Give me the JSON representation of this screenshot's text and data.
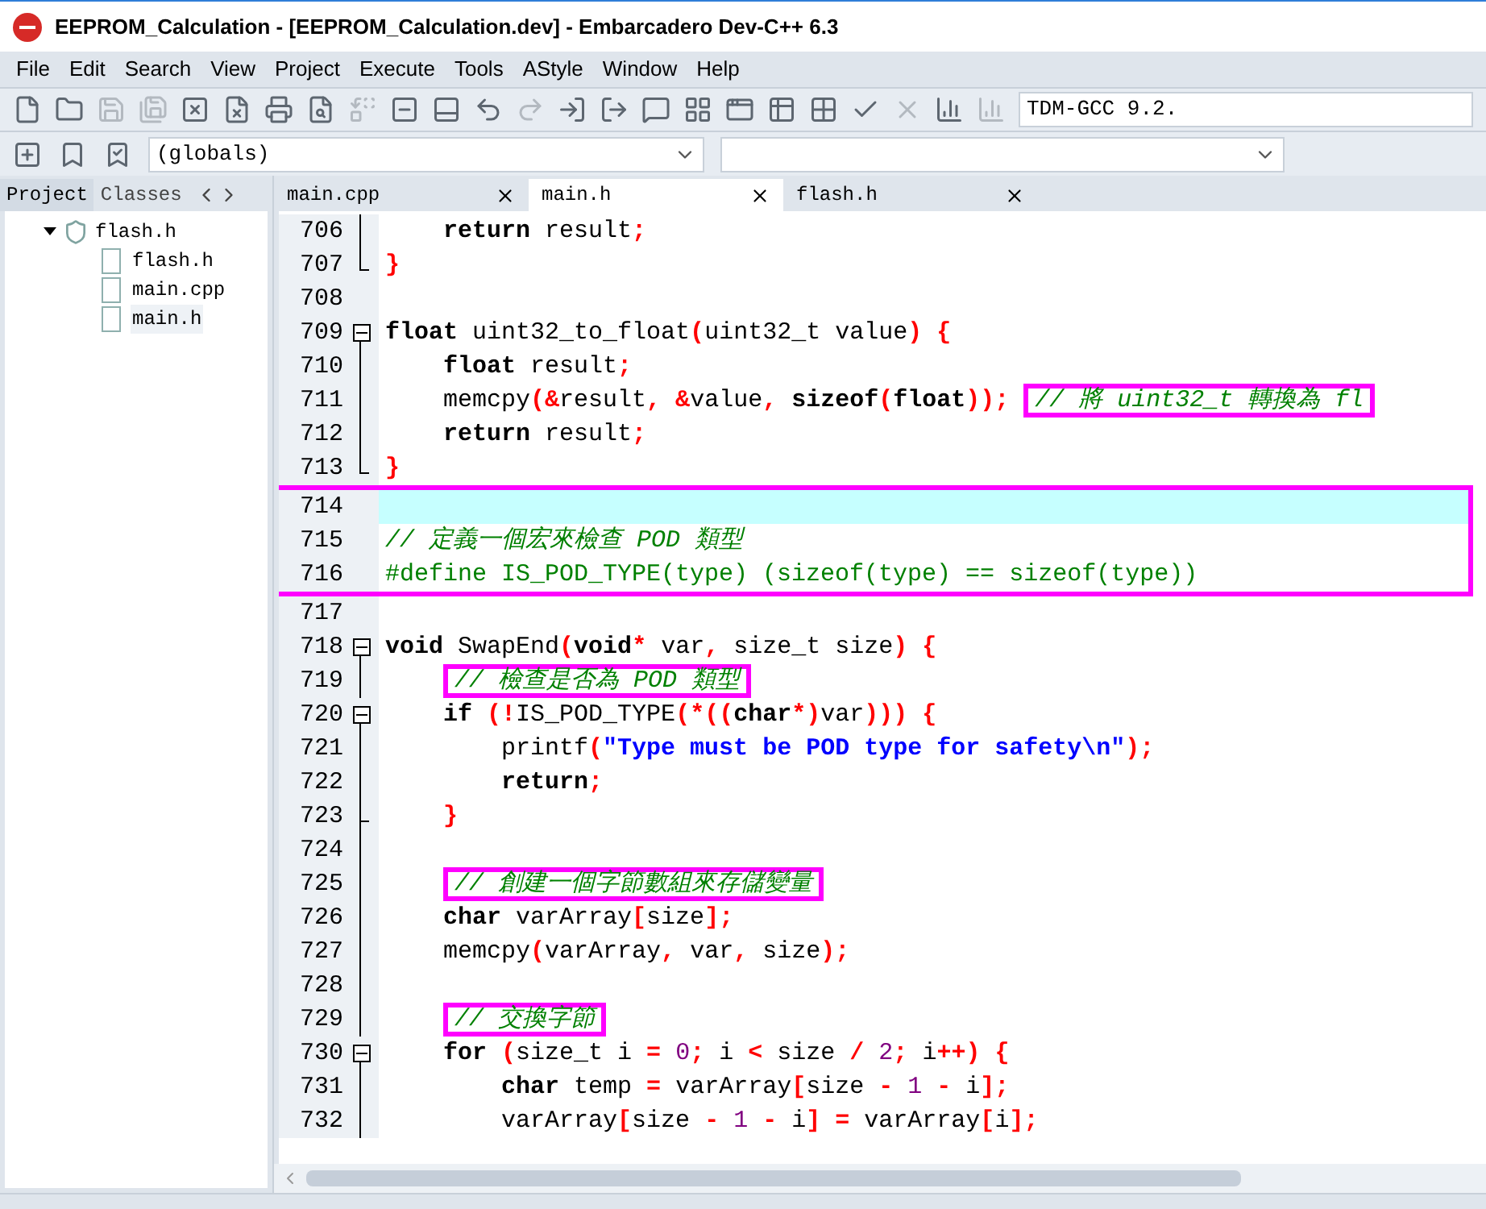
{
  "window": {
    "title": "EEPROM_Calculation - [EEPROM_Calculation.dev] - Embarcadero Dev-C++ 6.3"
  },
  "menu": [
    "File",
    "Edit",
    "Search",
    "View",
    "Project",
    "Execute",
    "Tools",
    "AStyle",
    "Window",
    "Help"
  ],
  "toolbar": {
    "compiler": "TDM-GCC 9.2.",
    "scope": "(globals)"
  },
  "side_tabs": [
    {
      "label": "Project",
      "selected": true
    },
    {
      "label": "Classes",
      "selected": false
    }
  ],
  "editor_tabs": [
    {
      "label": "main.cpp",
      "selected": false
    },
    {
      "label": "main.h",
      "selected": true
    },
    {
      "label": "flash.h",
      "selected": false
    }
  ],
  "project_tree": {
    "label": "flash.h",
    "expanded": true,
    "children": [
      {
        "label": "flash.h",
        "selected": false
      },
      {
        "label": "main.cpp",
        "selected": false
      },
      {
        "label": "main.h",
        "selected": true
      }
    ]
  },
  "code_blocks": [
    {
      "kind": "plain",
      "lines": [
        {
          "number": "706",
          "kind": "fold_line",
          "current": false,
          "segments": [
            {
              "kind": "keyword",
              "text": "    return"
            },
            {
              "kind": "plain",
              "text": " result"
            },
            {
              "kind": "symbol",
              "text": ";"
            }
          ]
        },
        {
          "number": "707",
          "kind": "fold_end",
          "current": false,
          "segments": [
            {
              "kind": "symbol",
              "text": "}"
            }
          ]
        },
        {
          "number": "708",
          "kind": "plain",
          "current": false
        },
        {
          "number": "709",
          "kind": "fold_open",
          "current": false,
          "segments": [
            {
              "kind": "keyword",
              "text": "float"
            },
            {
              "kind": "plain",
              "text": " uint32_to_float"
            },
            {
              "kind": "symbol",
              "text": "("
            },
            {
              "kind": "plain",
              "text": "uint32_t value"
            },
            {
              "kind": "symbol",
              "text": ")"
            },
            {
              "kind": "symbol",
              "text": " {"
            }
          ]
        },
        {
          "number": "710",
          "kind": "fold_line",
          "current": false,
          "segments": [
            {
              "kind": "keyword",
              "text": "    float"
            },
            {
              "kind": "plain",
              "text": " result"
            },
            {
              "kind": "symbol",
              "text": ";"
            }
          ]
        },
        {
          "number": "711",
          "kind": "fold_line",
          "current": false,
          "segments": [
            {
              "kind": "plain",
              "text": "    memcpy"
            },
            {
              "kind": "symbol",
              "text": "(&"
            },
            {
              "kind": "plain",
              "text": "result"
            },
            {
              "kind": "symbol",
              "text": ", &"
            },
            {
              "kind": "plain",
              "text": "value"
            },
            {
              "kind": "symbol",
              "text": ", "
            },
            {
              "kind": "keyword",
              "text": "sizeof"
            },
            {
              "kind": "symbol",
              "text": "("
            },
            {
              "kind": "keyword",
              "text": "float"
            },
            {
              "kind": "symbol",
              "text": "));"
            },
            {
              "kind": "boxed_comment",
              "text": "// 將 uint32_t 轉換為 fl"
            }
          ]
        },
        {
          "number": "712",
          "kind": "fold_line",
          "current": false,
          "segments": [
            {
              "kind": "keyword",
              "text": "    return"
            },
            {
              "kind": "plain",
              "text": " result"
            },
            {
              "kind": "symbol",
              "text": ";"
            }
          ]
        },
        {
          "number": "713",
          "kind": "fold_end",
          "current": false,
          "segments": [
            {
              "kind": "symbol",
              "text": "}"
            }
          ]
        }
      ]
    },
    {
      "kind": "boxed",
      "lines": [
        {
          "number": "714",
          "kind": "plain",
          "current": true
        },
        {
          "number": "715",
          "kind": "plain",
          "current": false,
          "segments": [
            {
              "kind": "comment",
              "text": "// 定義一個宏來檢查 POD 類型"
            }
          ]
        },
        {
          "number": "716",
          "kind": "plain",
          "current": false,
          "segments": [
            {
              "kind": "preprocessor",
              "text": "#define IS_POD_TYPE(type) (sizeof(type) == sizeof(type))"
            }
          ]
        }
      ]
    },
    {
      "kind": "plain",
      "lines": [
        {
          "number": "717",
          "kind": "plain",
          "current": false
        },
        {
          "number": "718",
          "kind": "fold_open",
          "current": false,
          "segments": [
            {
              "kind": "keyword",
              "text": "void"
            },
            {
              "kind": "plain",
              "text": " SwapEnd"
            },
            {
              "kind": "symbol",
              "text": "("
            },
            {
              "kind": "keyword",
              "text": "void"
            },
            {
              "kind": "symbol",
              "text": "*"
            },
            {
              "kind": "plain",
              "text": " var"
            },
            {
              "kind": "symbol",
              "text": ","
            },
            {
              "kind": "plain",
              "text": " size_t size"
            },
            {
              "kind": "symbol",
              "text": ")"
            },
            {
              "kind": "symbol",
              "text": " {"
            }
          ]
        },
        {
          "number": "719",
          "kind": "fold_line",
          "current": false,
          "segments": [
            {
              "kind": "boxed_comment",
              "text": "// 檢查是否為 POD 類型"
            }
          ]
        },
        {
          "number": "720",
          "kind": "fold_open",
          "current": false,
          "segments": [
            {
              "kind": "keyword",
              "text": "    if"
            },
            {
              "kind": "symbol",
              "text": " (!"
            },
            {
              "kind": "plain",
              "text": "IS_POD_TYPE"
            },
            {
              "kind": "symbol",
              "text": "(*(("
            },
            {
              "kind": "keyword",
              "text": "char"
            },
            {
              "kind": "symbol",
              "text": "*)"
            },
            {
              "kind": "plain",
              "text": "var"
            },
            {
              "kind": "symbol",
              "text": ")))"
            },
            {
              "kind": "symbol",
              "text": " {"
            }
          ]
        },
        {
          "number": "721",
          "kind": "fold_line",
          "current": false,
          "segments": [
            {
              "kind": "plain",
              "text": "        printf"
            },
            {
              "kind": "symbol",
              "text": "("
            },
            {
              "kind": "string",
              "text": "\"Type must be POD type for safety\\n\""
            },
            {
              "kind": "symbol",
              "text": ");"
            }
          ]
        },
        {
          "number": "722",
          "kind": "fold_line",
          "current": false,
          "segments": [
            {
              "kind": "keyword",
              "text": "        return"
            },
            {
              "kind": "symbol",
              "text": ";"
            }
          ]
        },
        {
          "number": "723",
          "kind": "fold_mid_end",
          "current": false,
          "segments": [
            {
              "kind": "symbol",
              "text": "    }"
            }
          ]
        },
        {
          "number": "724",
          "kind": "fold_line",
          "current": false
        },
        {
          "number": "725",
          "kind": "fold_line",
          "current": false,
          "segments": [
            {
              "kind": "boxed_comment",
              "text": "// 創建一個字節數組來存儲變量"
            }
          ]
        },
        {
          "number": "726",
          "kind": "fold_line",
          "current": false,
          "segments": [
            {
              "kind": "keyword",
              "text": "    char"
            },
            {
              "kind": "plain",
              "text": " varArray"
            },
            {
              "kind": "symbol",
              "text": "["
            },
            {
              "kind": "plain",
              "text": "size"
            },
            {
              "kind": "symbol",
              "text": "];"
            }
          ]
        },
        {
          "number": "727",
          "kind": "fold_line",
          "current": false,
          "segments": [
            {
              "kind": "plain",
              "text": "    memcpy"
            },
            {
              "kind": "symbol",
              "text": "("
            },
            {
              "kind": "plain",
              "text": "varArray"
            },
            {
              "kind": "symbol",
              "text": ","
            },
            {
              "kind": "plain",
              "text": " var"
            },
            {
              "kind": "symbol",
              "text": ","
            },
            {
              "kind": "plain",
              "text": " size"
            },
            {
              "kind": "symbol",
              "text": ");"
            }
          ]
        },
        {
          "number": "728",
          "kind": "fold_line",
          "current": false
        },
        {
          "number": "729",
          "kind": "fold_line",
          "current": false,
          "segments": [
            {
              "kind": "boxed_comment",
              "text": "// 交換字節"
            }
          ]
        },
        {
          "number": "730",
          "kind": "fold_open",
          "current": false,
          "segments": [
            {
              "kind": "keyword",
              "text": "    for"
            },
            {
              "kind": "symbol",
              "text": " ("
            },
            {
              "kind": "plain",
              "text": "size_t i "
            },
            {
              "kind": "symbol",
              "text": "="
            },
            {
              "kind": "number",
              "text": " 0"
            },
            {
              "kind": "symbol",
              "text": ";"
            },
            {
              "kind": "plain",
              "text": " i "
            },
            {
              "kind": "symbol",
              "text": "<"
            },
            {
              "kind": "plain",
              "text": " size "
            },
            {
              "kind": "symbol",
              "text": "/"
            },
            {
              "kind": "number",
              "text": " 2"
            },
            {
              "kind": "symbol",
              "text": ";"
            },
            {
              "kind": "plain",
              "text": " i"
            },
            {
              "kind": "symbol",
              "text": "++)"
            },
            {
              "kind": "symbol",
              "text": " {"
            }
          ]
        },
        {
          "number": "731",
          "kind": "fold_line",
          "current": false,
          "segments": [
            {
              "kind": "keyword",
              "text": "        char"
            },
            {
              "kind": "plain",
              "text": " temp "
            },
            {
              "kind": "symbol",
              "text": "="
            },
            {
              "kind": "plain",
              "text": " varArray"
            },
            {
              "kind": "symbol",
              "text": "["
            },
            {
              "kind": "plain",
              "text": "size "
            },
            {
              "kind": "symbol",
              "text": "-"
            },
            {
              "kind": "number",
              "text": " 1"
            },
            {
              "kind": "symbol",
              "text": " -"
            },
            {
              "kind": "plain",
              "text": " i"
            },
            {
              "kind": "symbol",
              "text": "];"
            }
          ]
        },
        {
          "number": "732",
          "kind": "fold_line",
          "current": false,
          "segments": [
            {
              "kind": "plain",
              "text": "        varArray"
            },
            {
              "kind": "symbol",
              "text": "["
            },
            {
              "kind": "plain",
              "text": "size "
            },
            {
              "kind": "symbol",
              "text": "-"
            },
            {
              "kind": "number",
              "text": " 1"
            },
            {
              "kind": "symbol",
              "text": " -"
            },
            {
              "kind": "plain",
              "text": " i"
            },
            {
              "kind": "symbol",
              "text": "]"
            },
            {
              "kind": "symbol",
              "text": " ="
            },
            {
              "kind": "plain",
              "text": " varArray"
            },
            {
              "kind": "symbol",
              "text": "["
            },
            {
              "kind": "plain",
              "text": "i"
            },
            {
              "kind": "symbol",
              "text": "];"
            }
          ]
        }
      ]
    }
  ]
}
